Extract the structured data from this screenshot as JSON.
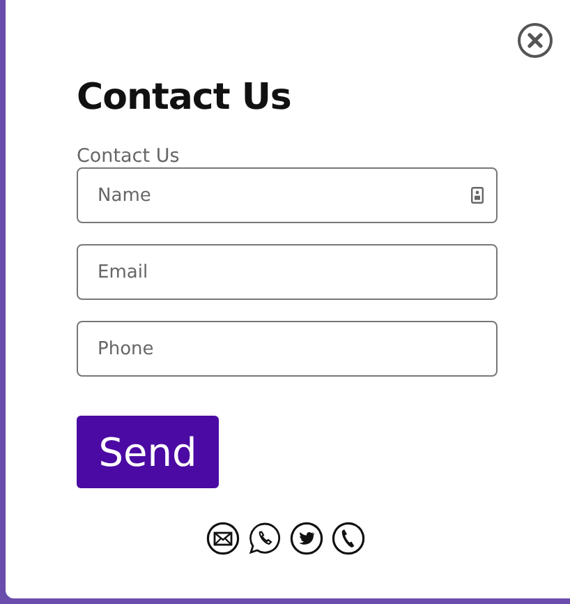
{
  "dialog": {
    "title": "Contact Us"
  },
  "form": {
    "label": "Contact Us",
    "fields": [
      {
        "placeholder": "Name",
        "autofill_icon": true
      },
      {
        "placeholder": "Email",
        "autofill_icon": false
      },
      {
        "placeholder": "Phone",
        "autofill_icon": false
      }
    ],
    "submit": "Send"
  },
  "social_links": [
    {
      "kind": "email"
    },
    {
      "kind": "whatsapp"
    },
    {
      "kind": "twitter"
    },
    {
      "kind": "phone"
    }
  ]
}
